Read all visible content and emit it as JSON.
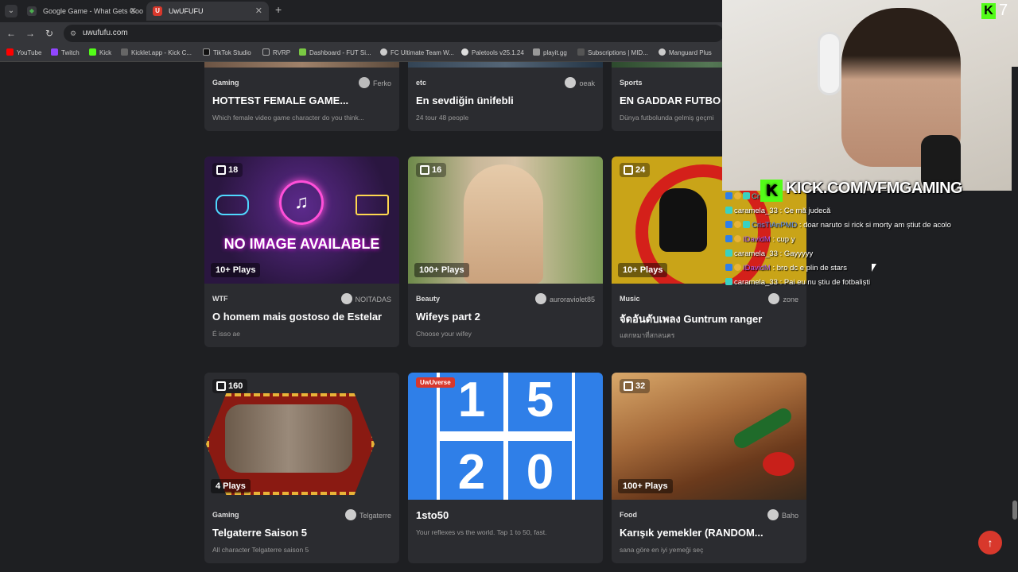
{
  "browser": {
    "tabs": [
      {
        "title": "Google Game - What Gets Goo..."
      },
      {
        "title": "UwUFUFU"
      }
    ],
    "url": "uwufufu.com",
    "bookmarks": [
      "YouTube",
      "Twitch",
      "Kick",
      "Kicklet.app - Kick C...",
      "TikTok Studio",
      "RVRP",
      "Dashboard - FUT Si...",
      "FC Ultimate Team W...",
      "Paletools v25.1.24",
      "playit.gg",
      "Subscriptions | MID...",
      "Manguard Plus"
    ]
  },
  "cards": [
    {
      "category": "Gaming",
      "author": "Ferko",
      "title": "HOTTEST FEMALE GAME...",
      "desc": "Which female video game character do you think..."
    },
    {
      "category": "etc",
      "author": "oeak",
      "title": "En sevdiğin ünifebli",
      "desc": "24 tour 48 people"
    },
    {
      "category": "Sports",
      "author": "",
      "title": "EN GADDAR FUTBO",
      "desc": "Dünya futbolunda gelmiş geçmi"
    },
    {
      "count": "18",
      "plays": "10+ Plays",
      "category": "WTF",
      "author": "NOITADAS",
      "title": "O homem mais gostoso de Estelar",
      "desc": "É isso ae",
      "noimage": "NO IMAGE AVAILABLE"
    },
    {
      "count": "16",
      "plays": "100+ Plays",
      "category": "Beauty",
      "author": "auroraviolet85",
      "title": "Wifeys part 2",
      "desc": "Choose your wifey"
    },
    {
      "count": "24",
      "plays": "10+ Plays",
      "category": "Music",
      "author": "zone",
      "title": "จัดอันดับเพลง Guntrum ranger",
      "desc": "แดกหมาที่สกลนคร"
    },
    {
      "count": "160",
      "plays": "4 Plays",
      "category": "Gaming",
      "author": "Telgaterre",
      "title": "Telgaterre Saison 5",
      "desc": "All character Telgaterre saison 5"
    },
    {
      "tag": "UwUverse",
      "category": "",
      "author": "",
      "title": "1sto50",
      "desc": "Your reflexes vs the world. Tap 1 to 50, fast.",
      "digits": [
        "1",
        "5",
        "2",
        "0"
      ]
    },
    {
      "count": "32",
      "plays": "100+ Plays",
      "category": "Food",
      "author": "Baho",
      "title": "Karışık yemekler (RANDOM...",
      "desc": "sana göre en iyi yemeği seç"
    }
  ],
  "stream": {
    "banner": "KICK.COM/VFMGAMING",
    "viewer_count": "7",
    "chat": [
      {
        "user": "Cr",
        "msg": ""
      },
      {
        "user": "caramela_33",
        "msg": ": Ce mă judecă"
      },
      {
        "user": "CrisTiAnPMD",
        "msg": ": doar naruto si rick si morty am știut de acolo"
      },
      {
        "user": "IDavidM",
        "msg": ": cup y"
      },
      {
        "user": "caramela_33",
        "msg": ": Gayyyyy"
      },
      {
        "user": "IDavidM",
        "msg": ": bro dc e plin de stars"
      },
      {
        "user": "caramela_33",
        "msg": ": Pai eu nu știu de fotbaliști"
      }
    ]
  },
  "colors": {
    "accent": "#d8382c",
    "kick": "#53fc18",
    "card": "#2b2c30",
    "bg": "#1e1f22"
  }
}
